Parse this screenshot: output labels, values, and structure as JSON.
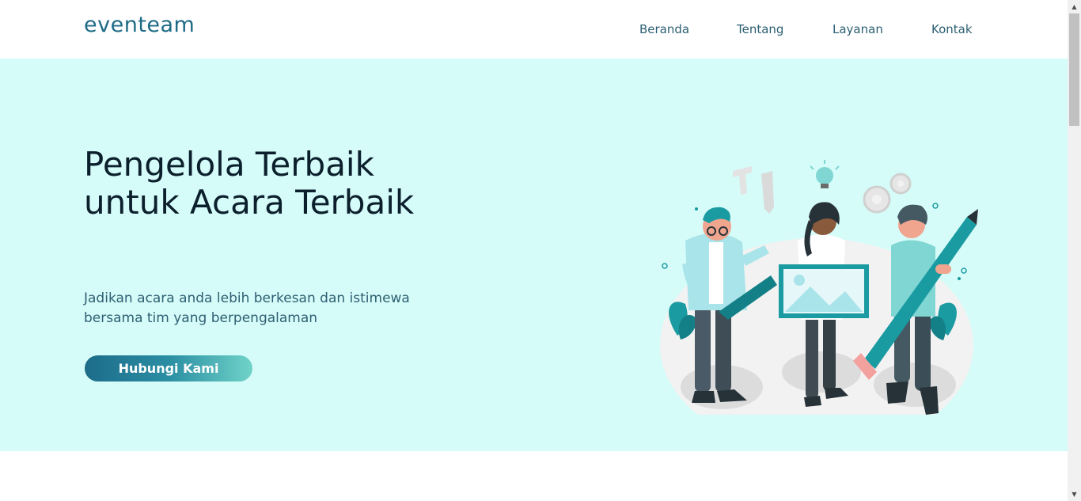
{
  "brand": "eventeam",
  "nav": {
    "items": [
      "Beranda",
      "Tentang",
      "Layanan",
      "Kontak"
    ]
  },
  "hero": {
    "title": "Pengelola Terbaik untuk Acara Terbaik",
    "subtitle": "Jadikan acara anda lebih berkesan dan istimewa bersama tim yang berpengalaman",
    "cta_label": "Hubungi Kami"
  },
  "colors": {
    "hero_bg": "#d5fcf8",
    "brand": "#1f6b86",
    "accent": "#1a9ba1",
    "cta_gradient_start": "#1d6c89",
    "cta_gradient_end": "#70d3c8"
  },
  "icons": {
    "scroll_up": "scroll-up-arrow-icon",
    "scroll_down": "scroll-down-arrow-icon"
  }
}
